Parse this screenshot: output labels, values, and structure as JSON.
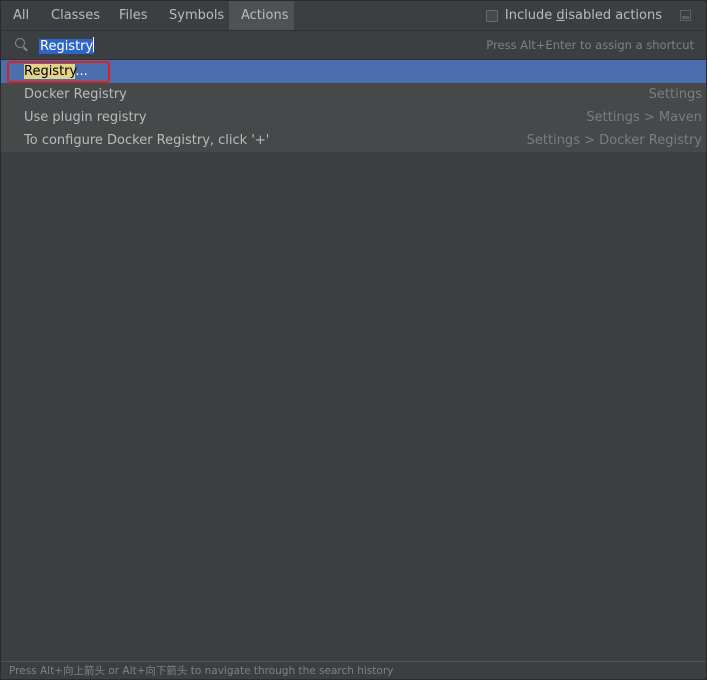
{
  "tabs": [
    {
      "label": "All"
    },
    {
      "label": "Classes"
    },
    {
      "label": "Files"
    },
    {
      "label": "Symbols"
    },
    {
      "label": "Actions"
    }
  ],
  "active_tab": "Actions",
  "include_disabled": {
    "prefix": "Include ",
    "mnemonic": "d",
    "suffix": "isabled actions",
    "checked": false
  },
  "search": {
    "value": "Registry",
    "hint": "Press Alt+Enter to assign a shortcut"
  },
  "results": [
    {
      "highlight": "Registry",
      "rest": "...",
      "location": "",
      "selected": true
    },
    {
      "highlight": "",
      "rest": "Docker Registry",
      "location": "Settings",
      "selected": false
    },
    {
      "highlight": "",
      "rest": "Use plugin registry",
      "location": "Settings > Maven",
      "selected": false
    },
    {
      "highlight": "",
      "rest": "To configure Docker Registry, click '+'",
      "location": "Settings > Docker Registry",
      "selected": false
    }
  ],
  "status": "Press Alt+向上箭头 or Alt+向下箭头 to navigate through the search history",
  "colors": {
    "selection": "#4b6eaf",
    "match_highlight": "#e3d488",
    "annotation_box": "#e0201b"
  }
}
